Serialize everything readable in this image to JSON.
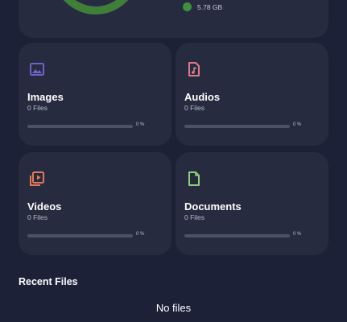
{
  "storage": {
    "legend": [
      {
        "label": "5.78 GB",
        "color": "#3f8f3f"
      }
    ],
    "ring_color": "#3f7f3a"
  },
  "categories": [
    {
      "title": "Images",
      "count": "0 Files",
      "percent": "0 %",
      "progress": 0,
      "icon": "image-icon",
      "color": "#6e63c9"
    },
    {
      "title": "Audios",
      "count": "0 Files",
      "percent": "0 %",
      "progress": 0,
      "icon": "audio-file-icon",
      "color": "#e07a8a"
    },
    {
      "title": "Videos",
      "count": "0 Files",
      "percent": "0 %",
      "progress": 0,
      "icon": "video-library-icon",
      "color": "#e27b55"
    },
    {
      "title": "Documents",
      "count": "0 Files",
      "percent": "0 %",
      "progress": 0,
      "icon": "document-icon",
      "color": "#8fd17a"
    }
  ],
  "recent": {
    "title": "Recent Files",
    "empty": "No files"
  }
}
